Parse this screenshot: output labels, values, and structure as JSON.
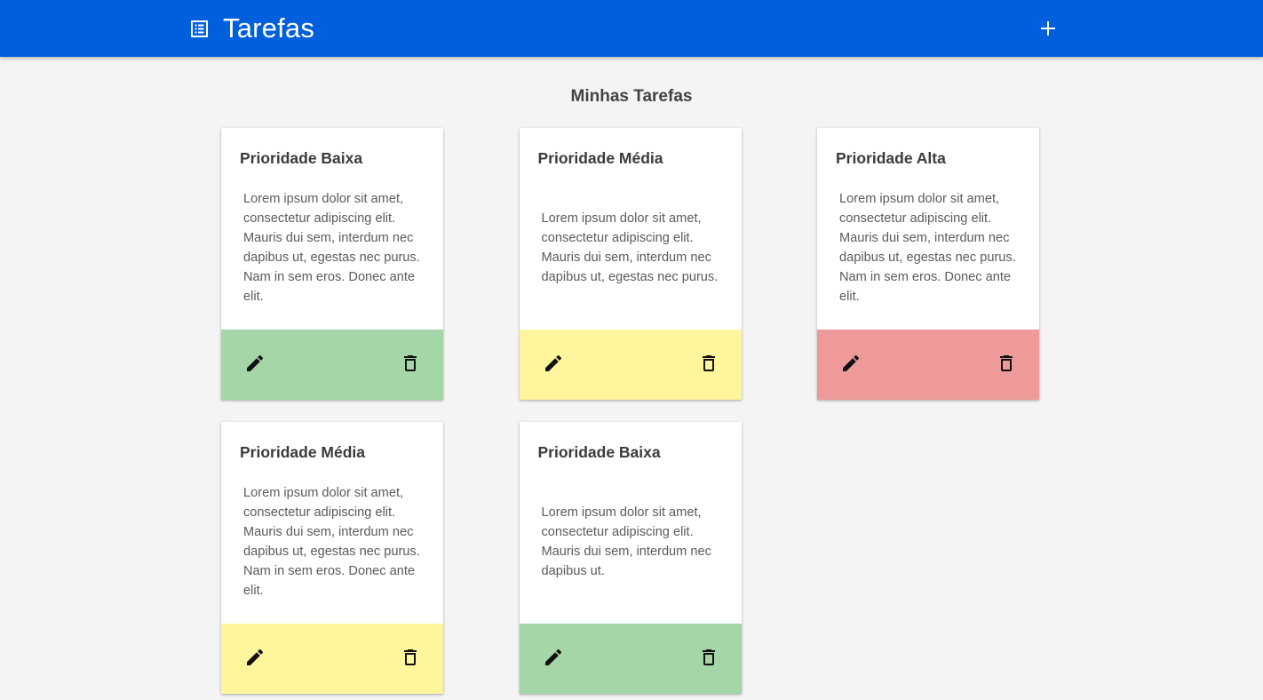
{
  "header": {
    "title": "Tarefas",
    "logo_icon": "list-alt-icon",
    "add_icon": "plus-icon",
    "background_color": "#005fdd"
  },
  "main": {
    "heading": "Minhas Tarefas"
  },
  "priority_colors": {
    "baixa": "#a5d6a7",
    "media": "#fff59d",
    "alta": "#ef9a9a"
  },
  "cards": [
    {
      "title": "Prioridade Baixa",
      "text": "Lorem ipsum dolor sit amet, consectetur adipiscing elit. Mauris dui sem, interdum nec dapibus ut, egestas nec purus. Nam in sem eros. Donec ante elit.",
      "priority": "baixa",
      "edit_icon": "pencil-icon",
      "delete_icon": "trash-icon"
    },
    {
      "title": "Prioridade Média",
      "text": "Lorem ipsum dolor sit amet, consectetur adipiscing elit. Mauris dui sem, interdum nec dapibus ut, egestas nec purus.",
      "priority": "media",
      "edit_icon": "pencil-icon",
      "delete_icon": "trash-icon"
    },
    {
      "title": "Prioridade Alta",
      "text": "Lorem ipsum dolor sit amet, consectetur adipiscing elit. Mauris dui sem, interdum nec dapibus ut, egestas nec purus. Nam in sem eros. Donec ante elit.",
      "priority": "alta",
      "edit_icon": "pencil-icon",
      "delete_icon": "trash-icon"
    },
    {
      "title": "Prioridade Média",
      "text": "Lorem ipsum dolor sit amet, consectetur adipiscing elit. Mauris dui sem, interdum nec dapibus ut, egestas nec purus. Nam in sem eros. Donec ante elit.",
      "priority": "media",
      "edit_icon": "pencil-icon",
      "delete_icon": "trash-icon"
    },
    {
      "title": "Prioridade Baixa",
      "text": "Lorem ipsum dolor sit amet, consectetur adipiscing elit. Mauris dui sem, interdum nec dapibus ut.",
      "priority": "baixa",
      "edit_icon": "pencil-icon",
      "delete_icon": "trash-icon"
    }
  ]
}
